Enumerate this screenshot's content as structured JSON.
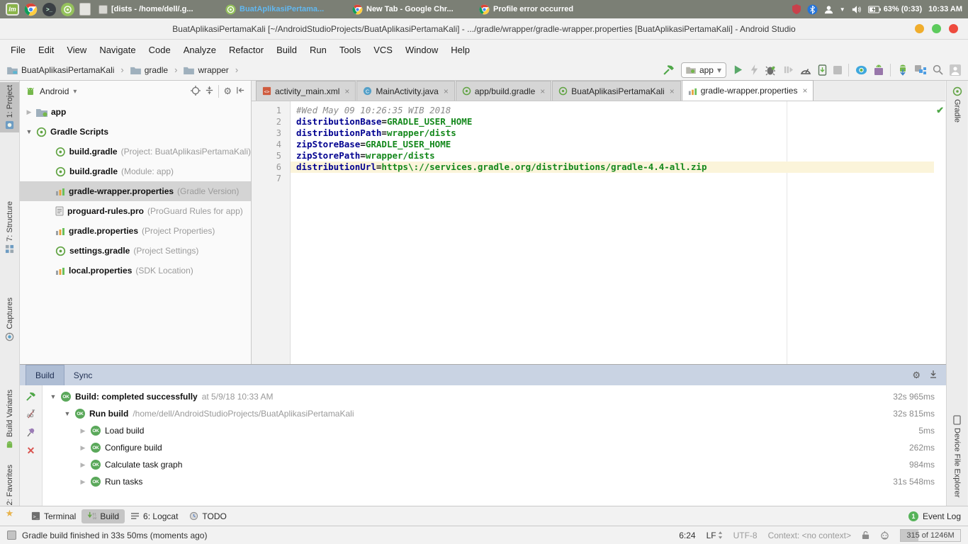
{
  "icons": {
    "expand": "▼",
    "collapse": "▶",
    "close": "×",
    "gear": "⚙",
    "check": "✔",
    "chevron": "›",
    "dropdown": "▾",
    "ok": "OK"
  },
  "taskbar": {
    "windows": [
      {
        "title": "[dists - /home/dell/.g...",
        "icon": "file-manager-icon"
      },
      {
        "title": "BuatAplikasiPertama...",
        "icon": "android-studio-icon"
      },
      {
        "title": "New Tab - Google Chr...",
        "icon": "chrome-icon"
      },
      {
        "title": "Profile error occurred",
        "icon": "chrome-icon"
      }
    ],
    "battery": "63% (0:33)",
    "clock": "10:33 AM"
  },
  "titlebar": {
    "title": "BuatAplikasiPertamaKali [~/AndroidStudioProjects/BuatAplikasiPertamaKali] - .../gradle/wrapper/gradle-wrapper.properties [BuatAplikasiPertamaKali] - Android Studio"
  },
  "menubar": {
    "items": [
      "File",
      "Edit",
      "View",
      "Navigate",
      "Code",
      "Analyze",
      "Refactor",
      "Build",
      "Run",
      "Tools",
      "VCS",
      "Window",
      "Help"
    ]
  },
  "navbar": {
    "breadcrumbs": [
      "BuatAplikasiPertamaKali",
      "gradle",
      "wrapper"
    ],
    "run_config": "app"
  },
  "stripes": {
    "left": [
      {
        "label": "1: Project"
      },
      {
        "label": "7: Structure"
      },
      {
        "label": "Captures"
      },
      {
        "label": "Build Variants"
      },
      {
        "label": "2: Favorites"
      }
    ],
    "right": [
      {
        "label": "Gradle"
      },
      {
        "label": "Device File Explorer"
      }
    ]
  },
  "project": {
    "view": "Android",
    "tree": [
      {
        "name": "app",
        "annotation": ""
      },
      {
        "name": "Gradle Scripts",
        "annotation": ""
      },
      {
        "name": "build.gradle",
        "annotation": "(Project: BuatAplikasiPertamaKali)"
      },
      {
        "name": "build.gradle",
        "annotation": "(Module: app)"
      },
      {
        "name": "gradle-wrapper.properties",
        "annotation": "(Gradle Version)"
      },
      {
        "name": "proguard-rules.pro",
        "annotation": "(ProGuard Rules for app)"
      },
      {
        "name": "gradle.properties",
        "annotation": "(Project Properties)"
      },
      {
        "name": "settings.gradle",
        "annotation": "(Project Settings)"
      },
      {
        "name": "local.properties",
        "annotation": "(SDK Location)"
      }
    ]
  },
  "editor": {
    "tabs": [
      {
        "label": "activity_main.xml"
      },
      {
        "label": "MainActivity.java"
      },
      {
        "label": "app/build.gradle"
      },
      {
        "label": "BuatAplikasiPertamaKali"
      },
      {
        "label": "gradle-wrapper.properties"
      }
    ],
    "gutter": [
      "1",
      "2",
      "3",
      "4",
      "5",
      "6",
      "7"
    ],
    "lines": [
      {
        "comment": "#Wed May 09 10:26:35 WIB 2018"
      },
      {
        "key": "distributionBase",
        "eq": "=",
        "value": "GRADLE_USER_HOME"
      },
      {
        "key": "distributionPath",
        "eq": "=",
        "value": "wrapper/dists"
      },
      {
        "key": "zipStoreBase",
        "eq": "=",
        "value": "GRADLE_USER_HOME"
      },
      {
        "key": "zipStorePath",
        "eq": "=",
        "value": "wrapper/dists"
      },
      {
        "key": "distributionUrl",
        "eq": "=",
        "value": "https\\://services.gradle.org/distributions/gradle-4.4-all.zip"
      }
    ]
  },
  "build": {
    "tabs": [
      "Build",
      "Sync"
    ],
    "rows": [
      {
        "label": "Build: completed successfully",
        "detail": "at 5/9/18 10:33 AM",
        "duration": "32s 965ms"
      },
      {
        "label": "Run build",
        "detail": "/home/dell/AndroidStudioProjects/BuatAplikasiPertamaKali",
        "duration": "32s 815ms"
      },
      {
        "label": "Load build",
        "detail": "",
        "duration": "5ms"
      },
      {
        "label": "Configure build",
        "detail": "",
        "duration": "262ms"
      },
      {
        "label": "Calculate task graph",
        "detail": "",
        "duration": "984ms"
      },
      {
        "label": "Run tasks",
        "detail": "",
        "duration": "31s 548ms"
      }
    ]
  },
  "bottom_bar": {
    "buttons": [
      "Terminal",
      "Build",
      "6: Logcat",
      "TODO"
    ],
    "event_log": "Event Log",
    "event_count": "1"
  },
  "statusbar": {
    "message": "Gradle build finished in 33s 50ms (moments ago)",
    "position": "6:24",
    "line_separator": "LF",
    "encoding": "UTF-8",
    "context": "Context: <no context>",
    "memory": "315 of 1246M"
  }
}
